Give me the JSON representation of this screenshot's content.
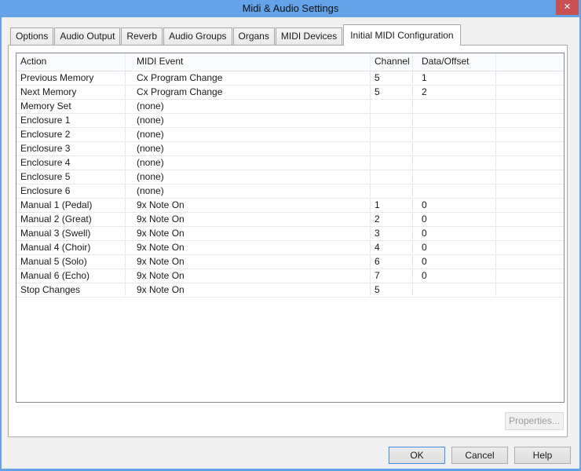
{
  "window": {
    "title": "Midi & Audio Settings",
    "close_glyph": "✕"
  },
  "tabs": {
    "items": [
      {
        "label": "Options",
        "active": false
      },
      {
        "label": "Audio Output",
        "active": false
      },
      {
        "label": "Reverb",
        "active": false
      },
      {
        "label": "Audio Groups",
        "active": false
      },
      {
        "label": "Organs",
        "active": false
      },
      {
        "label": "MIDI Devices",
        "active": false
      },
      {
        "label": "Initial MIDI Configuration",
        "active": true
      }
    ]
  },
  "table": {
    "columns": [
      "Action",
      "MIDI Event",
      "Channel",
      "Data/Offset",
      ""
    ],
    "rows": [
      [
        "Previous Memory",
        "Cx Program Change",
        "5",
        "1"
      ],
      [
        "Next Memory",
        "Cx Program Change",
        "5",
        "2"
      ],
      [
        "Memory Set",
        "(none)",
        "",
        ""
      ],
      [
        "Enclosure 1",
        "(none)",
        "",
        ""
      ],
      [
        "Enclosure 2",
        "(none)",
        "",
        ""
      ],
      [
        "Enclosure 3",
        "(none)",
        "",
        ""
      ],
      [
        "Enclosure 4",
        "(none)",
        "",
        ""
      ],
      [
        "Enclosure 5",
        "(none)",
        "",
        ""
      ],
      [
        "Enclosure 6",
        "(none)",
        "",
        ""
      ],
      [
        "Manual 1 (Pedal)",
        "9x Note On",
        "1",
        "0"
      ],
      [
        "Manual 2 (Great)",
        "9x Note On",
        "2",
        "0"
      ],
      [
        "Manual 3 (Swell)",
        "9x Note On",
        "3",
        "0"
      ],
      [
        "Manual 4 (Choir)",
        "9x Note On",
        "4",
        "0"
      ],
      [
        "Manual 5 (Solo)",
        "9x Note On",
        "6",
        "0"
      ],
      [
        "Manual 6 (Echo)",
        "9x Note On",
        "7",
        "0"
      ],
      [
        "Stop Changes",
        "9x Note On",
        "5",
        ""
      ]
    ]
  },
  "buttons": {
    "properties": "Properties...",
    "ok": "OK",
    "cancel": "Cancel",
    "help": "Help"
  },
  "colors": {
    "titlebar_blue": "#64a3e8",
    "close_red": "#c75050",
    "dialog_bg": "#f0f0f0",
    "panel_bg": "#ffffff",
    "table_border": "#828790",
    "gridline": "#e6e6e6",
    "ok_focus_border": "#3e8ee4",
    "button_face": "#e1e1e1",
    "button_border": "#adadad",
    "disabled_text": "#9a9a9a"
  }
}
